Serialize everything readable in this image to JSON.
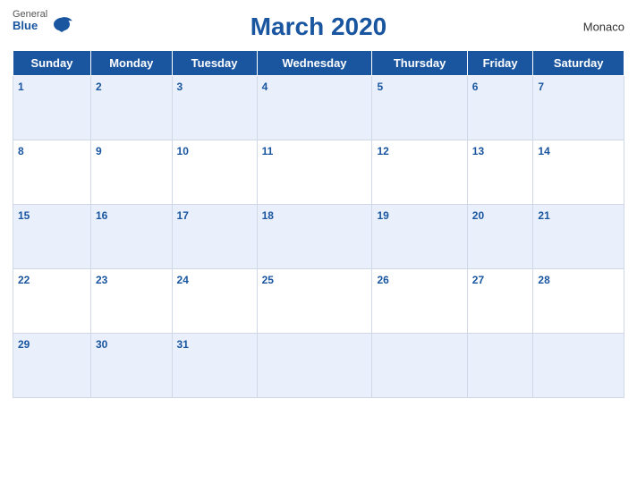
{
  "header": {
    "logo_general": "General",
    "logo_blue": "Blue",
    "title": "March 2020",
    "country": "Monaco"
  },
  "days_of_week": [
    "Sunday",
    "Monday",
    "Tuesday",
    "Wednesday",
    "Thursday",
    "Friday",
    "Saturday"
  ],
  "weeks": [
    [
      1,
      2,
      3,
      4,
      5,
      6,
      7
    ],
    [
      8,
      9,
      10,
      11,
      12,
      13,
      14
    ],
    [
      15,
      16,
      17,
      18,
      19,
      20,
      21
    ],
    [
      22,
      23,
      24,
      25,
      26,
      27,
      28
    ],
    [
      29,
      30,
      31,
      null,
      null,
      null,
      null
    ]
  ]
}
